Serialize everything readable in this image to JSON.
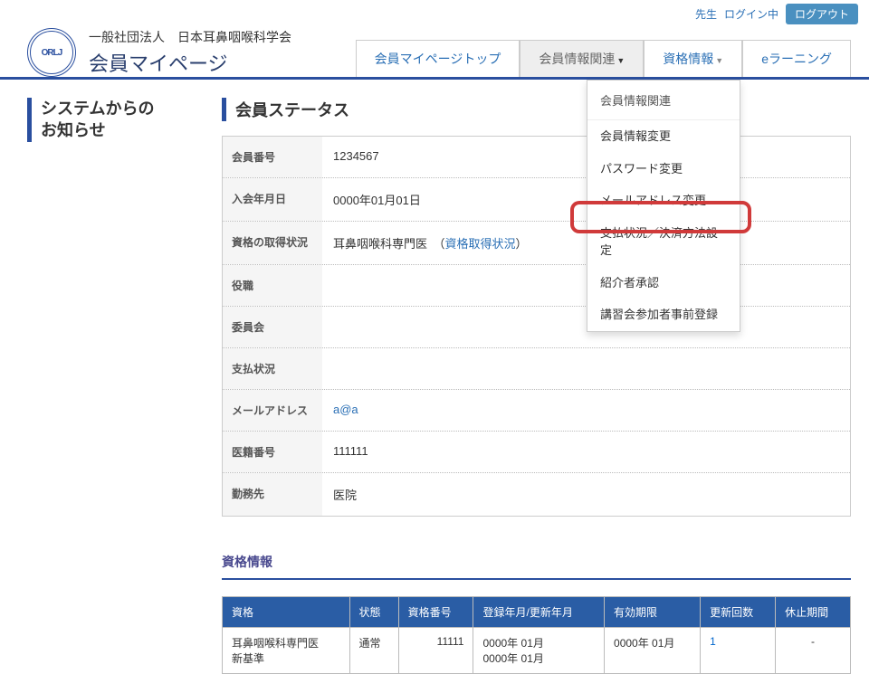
{
  "top": {
    "user_label": "先生",
    "login_status": "ログイン中",
    "logout": "ログアウト"
  },
  "header": {
    "logo_text": "ORLJ",
    "org": "一般社団法人　日本耳鼻咽喉科学会",
    "page": "会員マイページ"
  },
  "nav": {
    "items": [
      {
        "label": "会員マイページトップ"
      },
      {
        "label": "会員情報関連"
      },
      {
        "label": "資格情報"
      },
      {
        "label": "eラーニング"
      }
    ]
  },
  "dropdown": {
    "header": "会員情報関連",
    "items": [
      "会員情報変更",
      "パスワード変更",
      "メールアドレス変更",
      "支払状況／決済方法設定",
      "紹介者承認",
      "講習会参加者事前登録"
    ]
  },
  "sidebar": {
    "title_line1": "システムからの",
    "title_line2": "お知らせ"
  },
  "status": {
    "title": "会員ステータス",
    "rows": {
      "member_no": {
        "label": "会員番号",
        "value": "1234567"
      },
      "join_date": {
        "label": "入会年月日",
        "value": "0000年01月01日"
      },
      "qualification": {
        "label": "資格の取得状況",
        "value_prefix": "耳鼻咽喉科専門医　（",
        "link": "資格取得状況",
        "value_suffix": "）"
      },
      "position": {
        "label": "役職",
        "value": ""
      },
      "committee": {
        "label": "委員会",
        "value": ""
      },
      "payment": {
        "label": "支払状況",
        "value": ""
      },
      "email": {
        "label": "メールアドレス",
        "value": "a@a",
        "is_link": true
      },
      "doctor_no": {
        "label": "医籍番号",
        "value": "111111"
      },
      "workplace": {
        "label": "勤務先",
        "value": "医院"
      }
    }
  },
  "qualification": {
    "title": "資格情報",
    "headers": [
      "資格",
      "状態",
      "資格番号",
      "登録年月/更新年月",
      "有効期限",
      "更新回数",
      "休止期間"
    ],
    "row": {
      "name_l1": "耳鼻咽喉科専門医",
      "name_l2": "新基準",
      "state": "通常",
      "number": "11111",
      "reg_l1": "0000年 01月",
      "reg_l2": "0000年 01月",
      "expiry": "0000年 01月",
      "renew_count": "1",
      "pause": "-"
    }
  }
}
